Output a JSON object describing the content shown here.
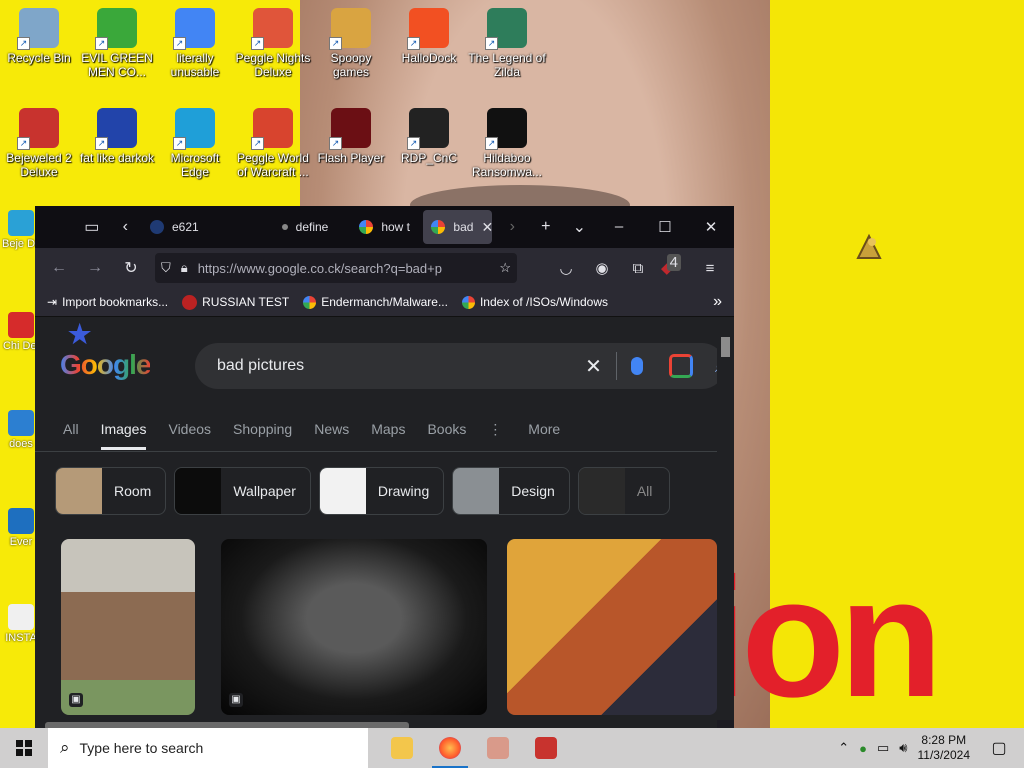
{
  "desktop": {
    "icons": [
      {
        "label": "Recycle Bin",
        "color": "#7fa6c9"
      },
      {
        "label": "EVIL GREEN MEN CO...",
        "color": "#3aa83a"
      },
      {
        "label": "literally unusable",
        "color": "#4285f4"
      },
      {
        "label": "Peggle Nights Deluxe",
        "color": "#e0553a"
      },
      {
        "label": "Spoopy games",
        "color": "#d9a441"
      },
      {
        "label": "HalloDock",
        "color": "#f25022"
      },
      {
        "label": "The Legend of Zilda",
        "color": "#2e7d5b"
      },
      {
        "label": "Bejeweled 2 Deluxe",
        "color": "#c8332e"
      },
      {
        "label": "fat like darkok",
        "color": "#2244aa"
      },
      {
        "label": "Microsoft Edge",
        "color": "#1f9fd8"
      },
      {
        "label": "Peggle World of Warcraft ...",
        "color": "#d8442e"
      },
      {
        "label": "Flash Player",
        "color": "#6b0f14"
      },
      {
        "label": "RDP_CnC",
        "color": "#222222"
      },
      {
        "label": "Hildaboo Ransomwa...",
        "color": "#111111"
      }
    ],
    "partial_icons": [
      {
        "label": "Beje Del",
        "color": "#2aa1d6"
      },
      {
        "label": "Chi Del",
        "color": "#d62b2b"
      },
      {
        "label": "does",
        "color": "#2c7fd1"
      },
      {
        "label": "Ever",
        "color": "#1e6fbf"
      },
      {
        "label": "INSTA",
        "color": "#f0f0f0"
      }
    ],
    "wallpaper_text": "ion"
  },
  "browser": {
    "tabs": [
      {
        "label": "e621",
        "active": false
      },
      {
        "label": "define",
        "active": false
      },
      {
        "label": "how t",
        "active": false
      },
      {
        "label": "bad",
        "active": true
      }
    ],
    "url": "https://www.google.co.ck/search?q=bad+p",
    "extension_badge": "4",
    "bookmarks": [
      {
        "label": "Import bookmarks..."
      },
      {
        "label": "RUSSIAN TEST"
      },
      {
        "label": "Endermanch/Malware..."
      },
      {
        "label": "Index of /ISOs/Windows"
      }
    ]
  },
  "google": {
    "logo": "Google",
    "query": "bad pictures",
    "tabs": [
      "All",
      "Images",
      "Videos",
      "Shopping",
      "News",
      "Maps",
      "Books",
      "More"
    ],
    "active_tab": "Images",
    "chips": [
      {
        "label": "Room",
        "color": "#b59a78"
      },
      {
        "label": "Wallpaper",
        "color": "#0c0c0c"
      },
      {
        "label": "Drawing",
        "color": "#f2f2f2"
      },
      {
        "label": "Design",
        "color": "#8a8f93"
      },
      {
        "label": "All",
        "color": "#2a2a2a"
      }
    ],
    "results": [
      {
        "name": "woman-smiling",
        "color": "#9a8a6e"
      },
      {
        "name": "dark-face",
        "color": "#1a1a1a"
      },
      {
        "name": "movie-poster",
        "color": "#c7762a"
      }
    ]
  },
  "taskbar": {
    "search_placeholder": "Type here to search",
    "time": "8:28 PM",
    "date": "11/3/2024"
  }
}
